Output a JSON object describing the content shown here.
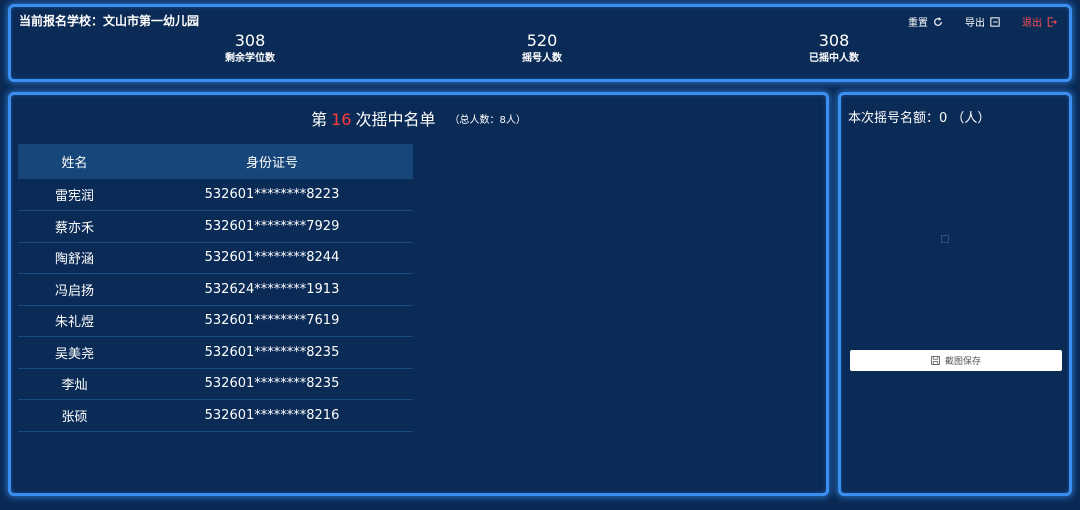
{
  "header": {
    "school_label": "当前报名学校：文山市第一幼儿园",
    "actions": {
      "reset": "重置",
      "export": "导出",
      "logout": "退出"
    }
  },
  "stats": [
    {
      "value": "308",
      "label": "剩余学位数"
    },
    {
      "value": "520",
      "label": "摇号人数"
    },
    {
      "value": "308",
      "label": "已摇中人数"
    }
  ],
  "list": {
    "title_prefix": "第",
    "round": "16",
    "title_suffix": "次摇中名单",
    "total": "（总人数：8人）",
    "columns": {
      "name": "姓名",
      "id": "身份证号"
    },
    "rows": [
      {
        "name": "雷宪润",
        "id": "532601********8223"
      },
      {
        "name": "蔡亦禾",
        "id": "532601********7929"
      },
      {
        "name": "陶舒涵",
        "id": "532601********8244"
      },
      {
        "name": "冯启扬",
        "id": "532624********1913"
      },
      {
        "name": "朱礼煜",
        "id": "532601********7619"
      },
      {
        "name": "吴美尧",
        "id": "532601********8235"
      },
      {
        "name": "李灿",
        "id": "532601********8235"
      },
      {
        "name": "张硕",
        "id": "532601********8216"
      }
    ]
  },
  "side": {
    "quota_label": "本次摇号名额：0 （人）",
    "save_button": "截图保存"
  },
  "colors": {
    "background": "#0a2a55",
    "border": "#3a8ff0",
    "header_row": "#16467a",
    "highlight": "#ff3b3b",
    "danger": "#ff4d4f"
  },
  "icons": {
    "reset": "refresh-icon",
    "export": "export-icon",
    "logout": "logout-icon",
    "save": "save-icon"
  }
}
